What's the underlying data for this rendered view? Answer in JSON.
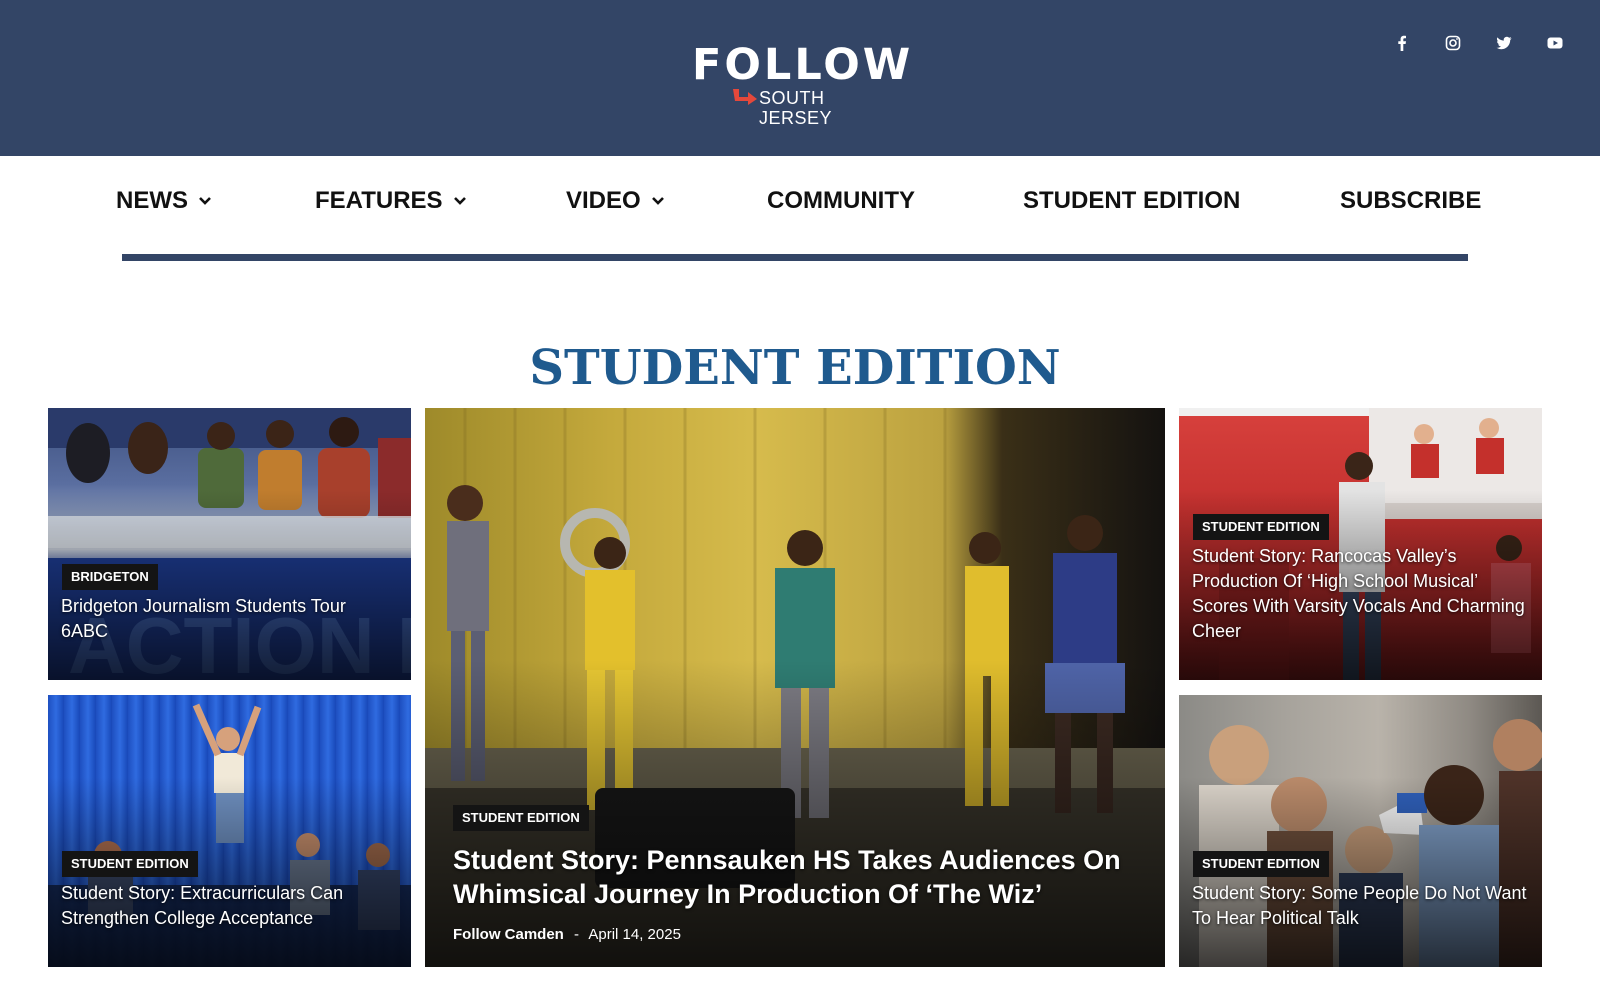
{
  "header": {
    "logo_main": "FOLLOW",
    "logo_sub": "SOUTH JERSEY",
    "background_color": "#334566",
    "accent_color": "#e5483b",
    "social": [
      {
        "name": "facebook-icon"
      },
      {
        "name": "instagram-icon"
      },
      {
        "name": "twitter-icon"
      },
      {
        "name": "youtube-icon"
      }
    ]
  },
  "nav": {
    "items": [
      {
        "label": "NEWS",
        "has_dropdown": true
      },
      {
        "label": "FEATURES",
        "has_dropdown": true
      },
      {
        "label": "VIDEO",
        "has_dropdown": true
      },
      {
        "label": "COMMUNITY",
        "has_dropdown": false
      },
      {
        "label": "STUDENT EDITION",
        "has_dropdown": false
      },
      {
        "label": "SUBSCRIBE",
        "has_dropdown": false
      }
    ]
  },
  "section": {
    "title": "STUDENT EDITION",
    "title_color": "#1f5a8e"
  },
  "cards": {
    "top_left": {
      "category": "BRIDGETON",
      "title": "Bridgeton Journalism Students Tour 6ABC"
    },
    "bottom_left": {
      "category": "STUDENT EDITION",
      "title": "Student Story: Extracurriculars Can Strengthen College Acceptance"
    },
    "featured": {
      "category": "STUDENT EDITION",
      "title": "Student Story: Pennsauken HS Takes Audiences On Whimsical Journey In Production Of ‘The Wiz’",
      "author": "Follow Camden",
      "separator": "-",
      "date": "April 14, 2025"
    },
    "top_right": {
      "category": "STUDENT EDITION",
      "title": "Student Story: Rancocas Valley’s Production Of ‘High School Musical’ Scores With Varsity Vocals And Charming Cheer"
    },
    "bottom_right": {
      "category": "STUDENT EDITION",
      "title": "Student Story: Some People Do Not Want To Hear Political Talk"
    }
  }
}
